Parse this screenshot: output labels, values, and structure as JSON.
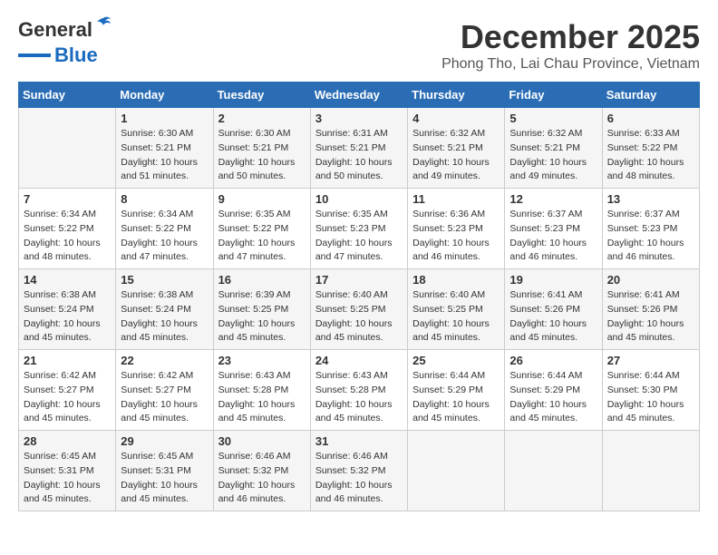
{
  "header": {
    "logo_line1": "General",
    "logo_line2": "Blue",
    "month_title": "December 2025",
    "subtitle": "Phong Tho, Lai Chau Province, Vietnam"
  },
  "days_of_week": [
    "Sunday",
    "Monday",
    "Tuesday",
    "Wednesday",
    "Thursday",
    "Friday",
    "Saturday"
  ],
  "weeks": [
    [
      {
        "day": "",
        "sunrise": "",
        "sunset": "",
        "daylight": ""
      },
      {
        "day": "1",
        "sunrise": "Sunrise: 6:30 AM",
        "sunset": "Sunset: 5:21 PM",
        "daylight": "Daylight: 10 hours and 51 minutes."
      },
      {
        "day": "2",
        "sunrise": "Sunrise: 6:30 AM",
        "sunset": "Sunset: 5:21 PM",
        "daylight": "Daylight: 10 hours and 50 minutes."
      },
      {
        "day": "3",
        "sunrise": "Sunrise: 6:31 AM",
        "sunset": "Sunset: 5:21 PM",
        "daylight": "Daylight: 10 hours and 50 minutes."
      },
      {
        "day": "4",
        "sunrise": "Sunrise: 6:32 AM",
        "sunset": "Sunset: 5:21 PM",
        "daylight": "Daylight: 10 hours and 49 minutes."
      },
      {
        "day": "5",
        "sunrise": "Sunrise: 6:32 AM",
        "sunset": "Sunset: 5:21 PM",
        "daylight": "Daylight: 10 hours and 49 minutes."
      },
      {
        "day": "6",
        "sunrise": "Sunrise: 6:33 AM",
        "sunset": "Sunset: 5:22 PM",
        "daylight": "Daylight: 10 hours and 48 minutes."
      }
    ],
    [
      {
        "day": "7",
        "sunrise": "Sunrise: 6:34 AM",
        "sunset": "Sunset: 5:22 PM",
        "daylight": "Daylight: 10 hours and 48 minutes."
      },
      {
        "day": "8",
        "sunrise": "Sunrise: 6:34 AM",
        "sunset": "Sunset: 5:22 PM",
        "daylight": "Daylight: 10 hours and 47 minutes."
      },
      {
        "day": "9",
        "sunrise": "Sunrise: 6:35 AM",
        "sunset": "Sunset: 5:22 PM",
        "daylight": "Daylight: 10 hours and 47 minutes."
      },
      {
        "day": "10",
        "sunrise": "Sunrise: 6:35 AM",
        "sunset": "Sunset: 5:23 PM",
        "daylight": "Daylight: 10 hours and 47 minutes."
      },
      {
        "day": "11",
        "sunrise": "Sunrise: 6:36 AM",
        "sunset": "Sunset: 5:23 PM",
        "daylight": "Daylight: 10 hours and 46 minutes."
      },
      {
        "day": "12",
        "sunrise": "Sunrise: 6:37 AM",
        "sunset": "Sunset: 5:23 PM",
        "daylight": "Daylight: 10 hours and 46 minutes."
      },
      {
        "day": "13",
        "sunrise": "Sunrise: 6:37 AM",
        "sunset": "Sunset: 5:23 PM",
        "daylight": "Daylight: 10 hours and 46 minutes."
      }
    ],
    [
      {
        "day": "14",
        "sunrise": "Sunrise: 6:38 AM",
        "sunset": "Sunset: 5:24 PM",
        "daylight": "Daylight: 10 hours and 45 minutes."
      },
      {
        "day": "15",
        "sunrise": "Sunrise: 6:38 AM",
        "sunset": "Sunset: 5:24 PM",
        "daylight": "Daylight: 10 hours and 45 minutes."
      },
      {
        "day": "16",
        "sunrise": "Sunrise: 6:39 AM",
        "sunset": "Sunset: 5:25 PM",
        "daylight": "Daylight: 10 hours and 45 minutes."
      },
      {
        "day": "17",
        "sunrise": "Sunrise: 6:40 AM",
        "sunset": "Sunset: 5:25 PM",
        "daylight": "Daylight: 10 hours and 45 minutes."
      },
      {
        "day": "18",
        "sunrise": "Sunrise: 6:40 AM",
        "sunset": "Sunset: 5:25 PM",
        "daylight": "Daylight: 10 hours and 45 minutes."
      },
      {
        "day": "19",
        "sunrise": "Sunrise: 6:41 AM",
        "sunset": "Sunset: 5:26 PM",
        "daylight": "Daylight: 10 hours and 45 minutes."
      },
      {
        "day": "20",
        "sunrise": "Sunrise: 6:41 AM",
        "sunset": "Sunset: 5:26 PM",
        "daylight": "Daylight: 10 hours and 45 minutes."
      }
    ],
    [
      {
        "day": "21",
        "sunrise": "Sunrise: 6:42 AM",
        "sunset": "Sunset: 5:27 PM",
        "daylight": "Daylight: 10 hours and 45 minutes."
      },
      {
        "day": "22",
        "sunrise": "Sunrise: 6:42 AM",
        "sunset": "Sunset: 5:27 PM",
        "daylight": "Daylight: 10 hours and 45 minutes."
      },
      {
        "day": "23",
        "sunrise": "Sunrise: 6:43 AM",
        "sunset": "Sunset: 5:28 PM",
        "daylight": "Daylight: 10 hours and 45 minutes."
      },
      {
        "day": "24",
        "sunrise": "Sunrise: 6:43 AM",
        "sunset": "Sunset: 5:28 PM",
        "daylight": "Daylight: 10 hours and 45 minutes."
      },
      {
        "day": "25",
        "sunrise": "Sunrise: 6:44 AM",
        "sunset": "Sunset: 5:29 PM",
        "daylight": "Daylight: 10 hours and 45 minutes."
      },
      {
        "day": "26",
        "sunrise": "Sunrise: 6:44 AM",
        "sunset": "Sunset: 5:29 PM",
        "daylight": "Daylight: 10 hours and 45 minutes."
      },
      {
        "day": "27",
        "sunrise": "Sunrise: 6:44 AM",
        "sunset": "Sunset: 5:30 PM",
        "daylight": "Daylight: 10 hours and 45 minutes."
      }
    ],
    [
      {
        "day": "28",
        "sunrise": "Sunrise: 6:45 AM",
        "sunset": "Sunset: 5:31 PM",
        "daylight": "Daylight: 10 hours and 45 minutes."
      },
      {
        "day": "29",
        "sunrise": "Sunrise: 6:45 AM",
        "sunset": "Sunset: 5:31 PM",
        "daylight": "Daylight: 10 hours and 45 minutes."
      },
      {
        "day": "30",
        "sunrise": "Sunrise: 6:46 AM",
        "sunset": "Sunset: 5:32 PM",
        "daylight": "Daylight: 10 hours and 46 minutes."
      },
      {
        "day": "31",
        "sunrise": "Sunrise: 6:46 AM",
        "sunset": "Sunset: 5:32 PM",
        "daylight": "Daylight: 10 hours and 46 minutes."
      },
      {
        "day": "",
        "sunrise": "",
        "sunset": "",
        "daylight": ""
      },
      {
        "day": "",
        "sunrise": "",
        "sunset": "",
        "daylight": ""
      },
      {
        "day": "",
        "sunrise": "",
        "sunset": "",
        "daylight": ""
      }
    ]
  ]
}
